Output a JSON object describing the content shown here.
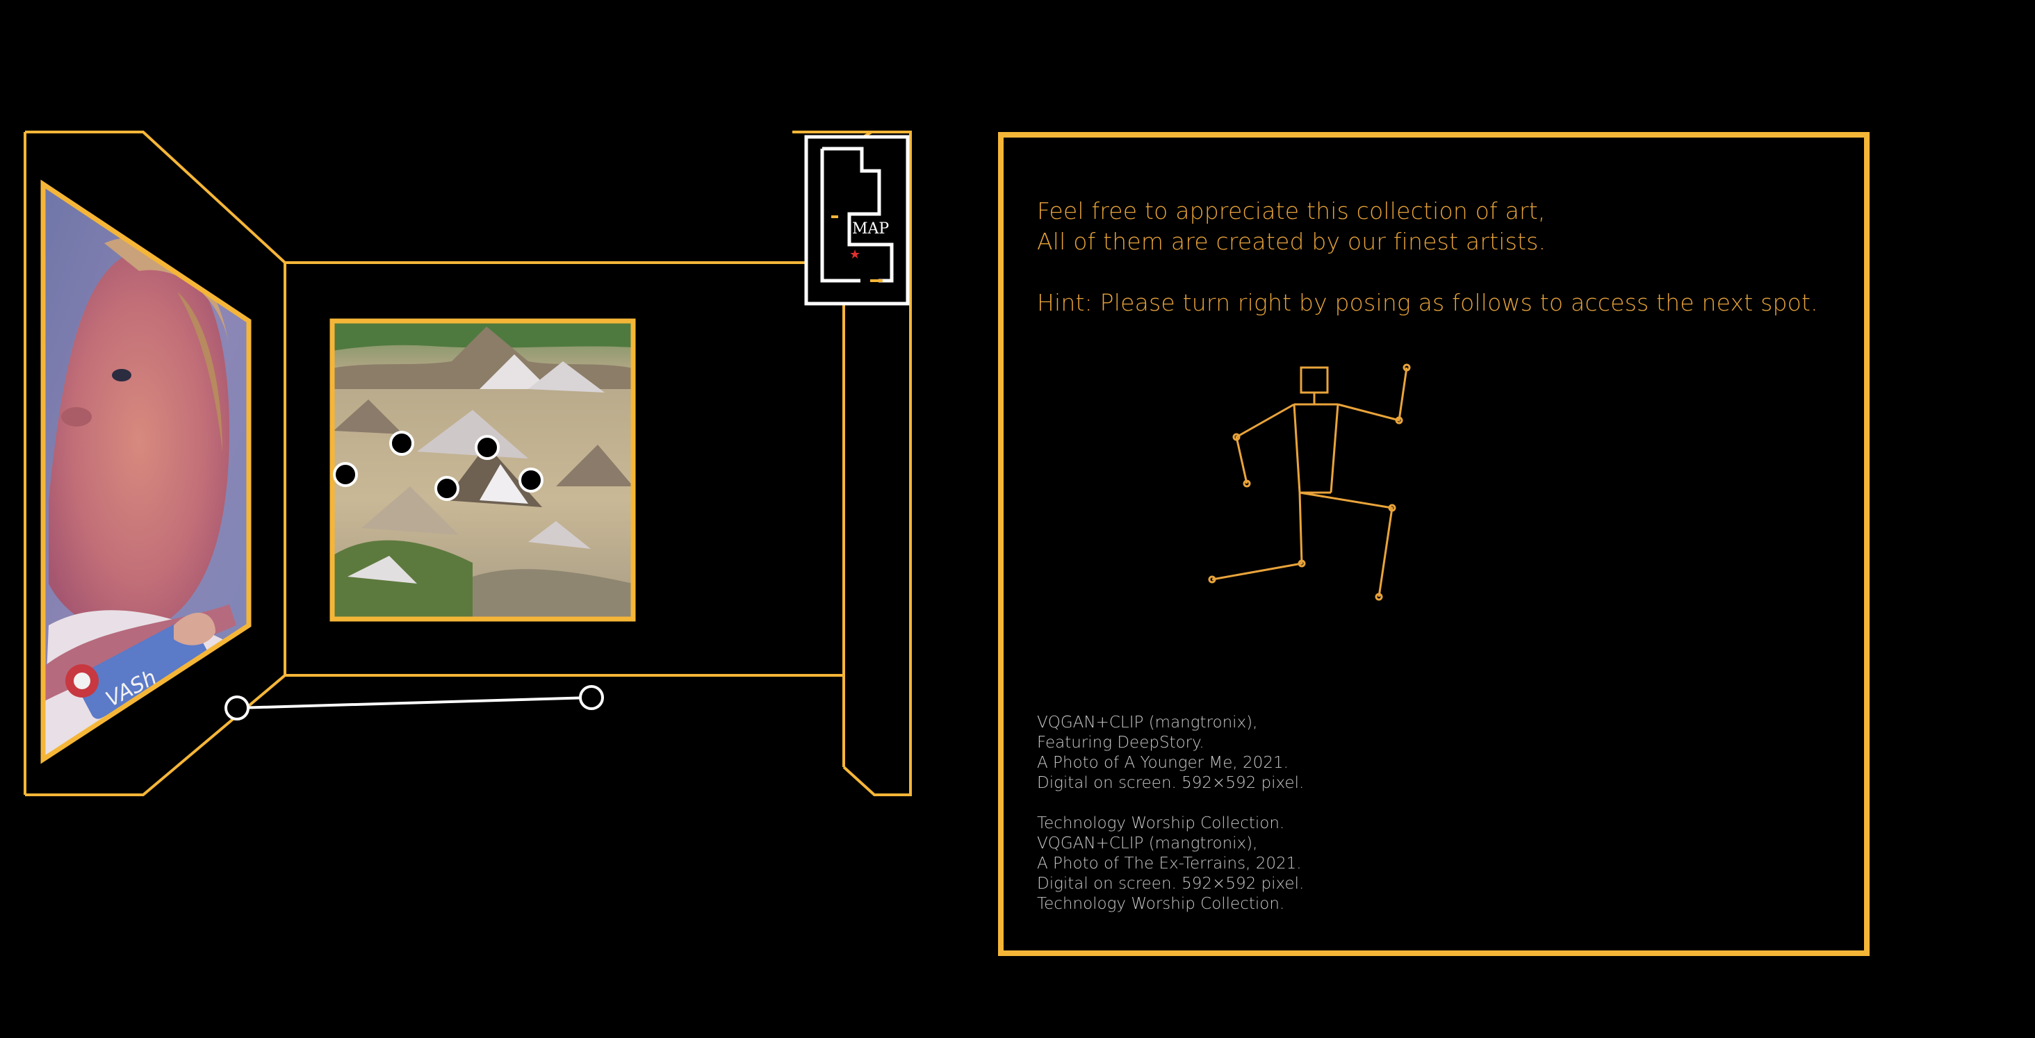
{
  "colors": {
    "accent": "#f5b638",
    "text_accent": "#e9a43b",
    "credits": "#c9c9c9",
    "background": "#000000",
    "marker_star": "#e03030"
  },
  "minimap": {
    "label": "MAP"
  },
  "message": {
    "line1": "Feel free to appreciate this collection of art,",
    "line2": "All of them are created by our finest artists.",
    "hint": "Hint: Please turn right by posing as follows to access the next spot."
  },
  "pose_figure": {
    "name": "turn-right-pose",
    "icon": "stick-figure-icon"
  },
  "credits": [
    "VQGAN+CLIP (mangtronix),",
    "Featuring DeepStory.",
    "A Photo of A Younger Me, 2021.",
    "Digital on screen. 592×592 pixel.",
    "",
    "Technology Worship Collection.",
    "VQGAN+CLIP (mangtronix),",
    "A Photo of The Ex-Terrains, 2021.",
    "Digital on screen. 592×592 pixel.",
    "Technology Worship Collection."
  ],
  "artworks": [
    {
      "name": "a-photo-of-a-younger-me",
      "depicts": "distorted baby portrait",
      "badge_text": "VASh"
    },
    {
      "name": "a-photo-of-the-ex-terrains",
      "depicts": "eroded hills landscape"
    }
  ]
}
